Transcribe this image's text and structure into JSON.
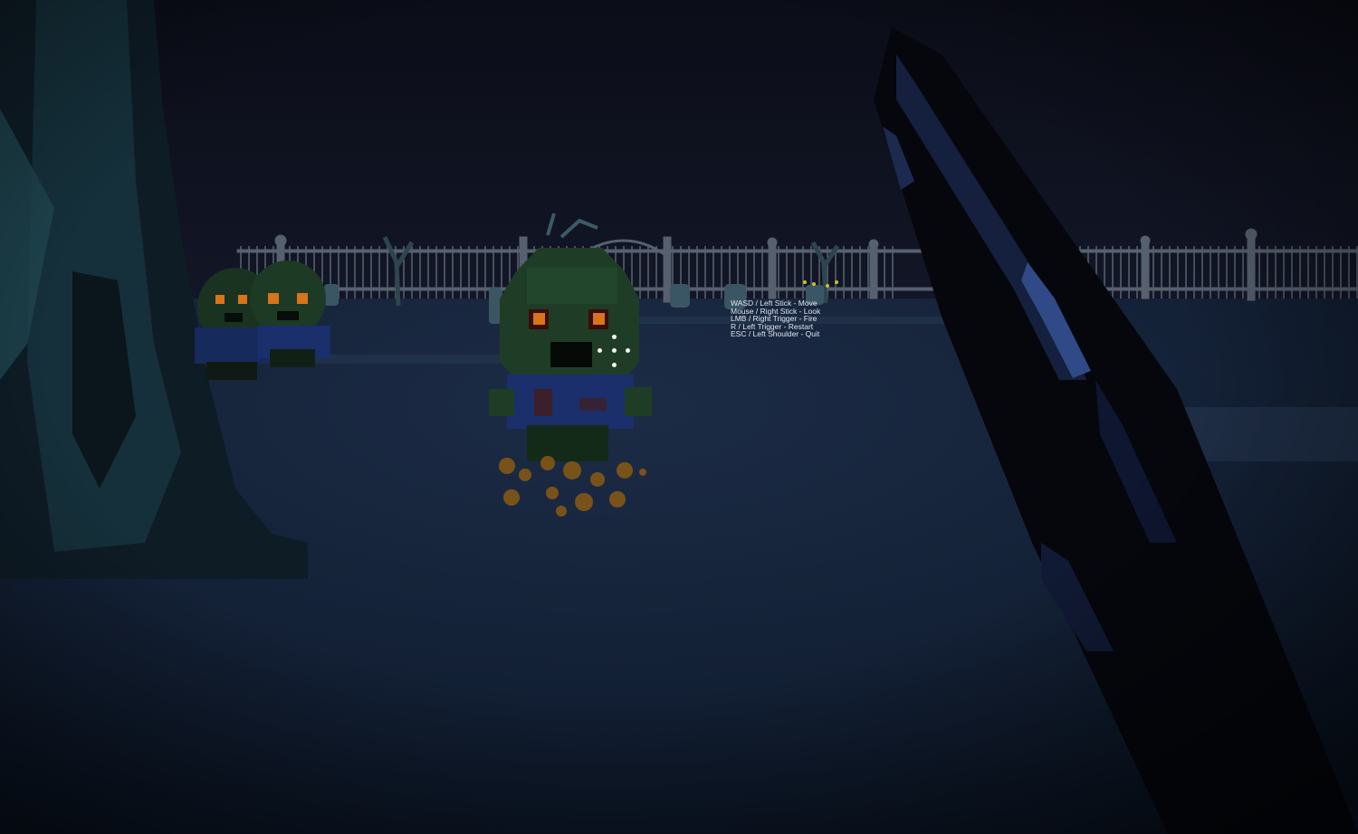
{
  "hud": {
    "controls": [
      "WASD / Left Stick - Move",
      "Mouse / Right Stick - Look",
      "LMB / Right Trigger - Fire",
      "R / Left Trigger - Restart",
      "ESC / Left Shoulder - Quit"
    ]
  },
  "scene": {
    "sky_color": "#0d0f1a",
    "ground_color": "#16233a",
    "zombie_skin": "#1f3d26",
    "zombie_shirt": "#1a2f6b",
    "zombie_eyes": "#d8741a",
    "crosshair_color": "#ffffff",
    "icons": [
      "crosshair-icon",
      "zombie-sprite",
      "shotgun-barrel",
      "graveyard-fence",
      "tombstone"
    ]
  }
}
